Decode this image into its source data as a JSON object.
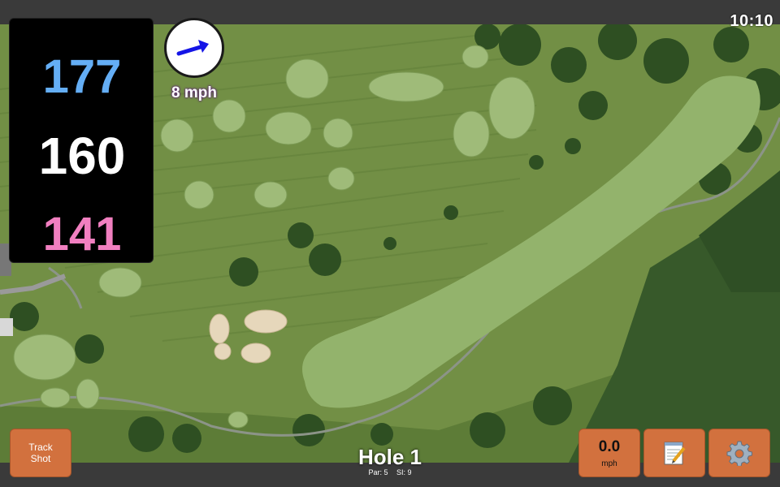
{
  "status": {
    "time": "10:10"
  },
  "distances": {
    "back": "177",
    "center": "160",
    "front": "141"
  },
  "wind": {
    "speed": "8 mph",
    "icon": "wind-arrow-icon"
  },
  "hole": {
    "title": "Hole 1",
    "par": "Par: 5",
    "si": "SI: 9"
  },
  "buttons": {
    "track_shot_line1": "Track",
    "track_shot_line2": "Shot",
    "speed_value": "0.0",
    "speed_unit": "mph",
    "notes_icon": "notepad-icon",
    "settings_icon": "gear-icon"
  },
  "colors": {
    "back": "#64aef5",
    "center": "#ffffff",
    "front": "#f17fc0",
    "button": "#d2713e",
    "wind_arrow": "#1515e6"
  }
}
